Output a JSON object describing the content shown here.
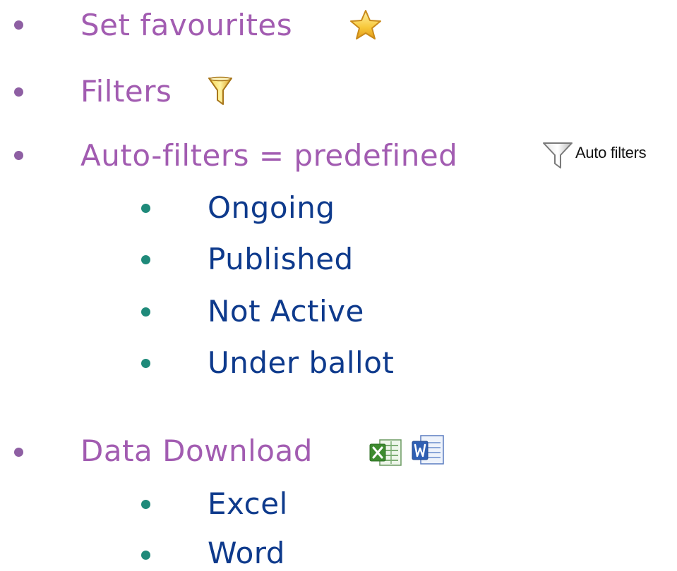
{
  "list": {
    "set_favourites": "Set favourites",
    "filters": "Filters",
    "auto_filters": {
      "label": "Auto-filters = predefined",
      "button_label": "Auto filters",
      "items": [
        "Ongoing",
        "Published",
        "Not Active",
        "Under ballot"
      ]
    },
    "data_download": {
      "label": "Data Download",
      "items": [
        "Excel",
        "Word"
      ]
    }
  },
  "icons": {
    "favourite": "star-icon",
    "filter": "funnel-icon",
    "auto_filter": "funnel-outline-icon",
    "excel": "excel-icon",
    "word": "word-icon"
  },
  "colors": {
    "primary_text": "#a25cb1",
    "secondary_text": "#0e3a8c",
    "primary_bullet": "#8e5fa3",
    "secondary_bullet": "#1f8a7a"
  }
}
